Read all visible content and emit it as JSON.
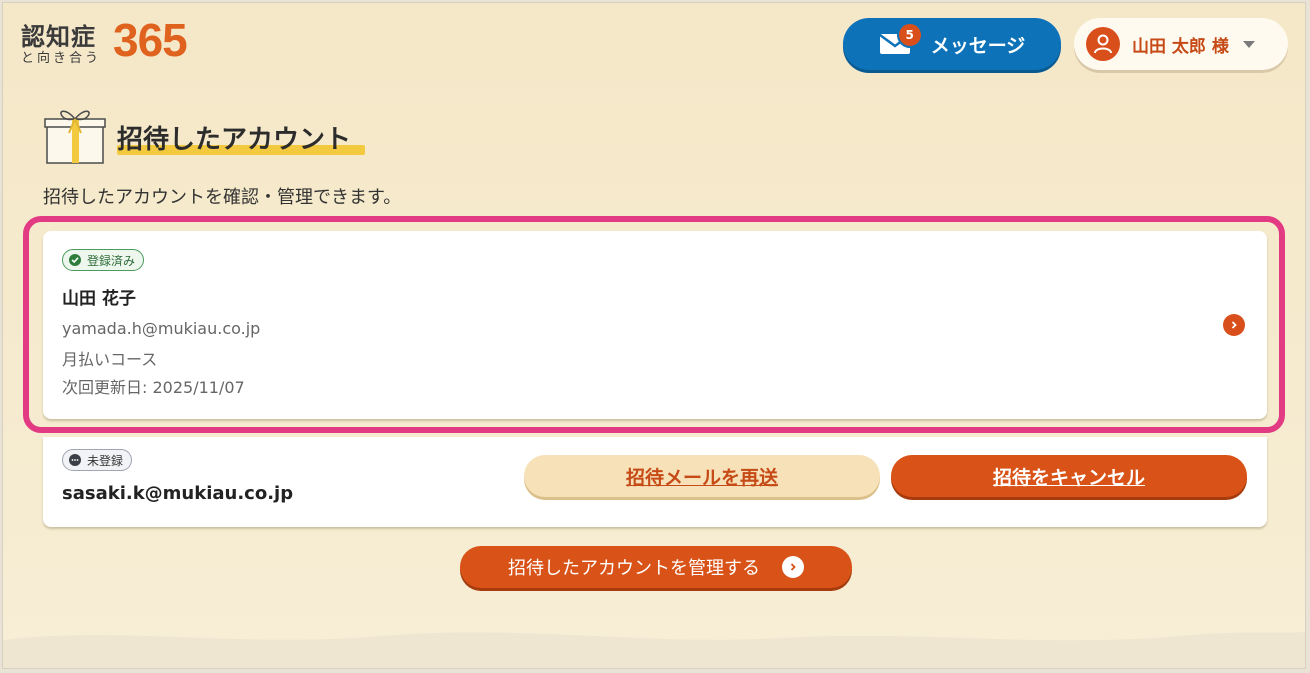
{
  "header": {
    "logo": {
      "main": "認知症",
      "sub": "と向き合う",
      "number": "365"
    },
    "message_button": {
      "label": "メッセージ",
      "badge_count": "5"
    },
    "user_menu": {
      "label": "山田 太郎 様"
    }
  },
  "page": {
    "title": "招待したアカウント",
    "description": "招待したアカウントを確認・管理できます。"
  },
  "accounts": [
    {
      "status": "登録済み",
      "name": "山田 花子",
      "email": "yamada.h@mukiau.co.jp",
      "course": "月払いコース",
      "renewal": "次回更新日: 2025/11/07"
    },
    {
      "status": "未登録",
      "email": "sasaki.k@mukiau.co.jp",
      "resend_label": "招待メールを再送",
      "cancel_label": "招待をキャンセル"
    }
  ],
  "manage_button": {
    "label": "招待したアカウントを管理する"
  },
  "colors": {
    "accent": "#d95217",
    "primary_blue": "#0d72b8",
    "highlight": "#e23b84",
    "title_underline": "#f3c93f"
  }
}
